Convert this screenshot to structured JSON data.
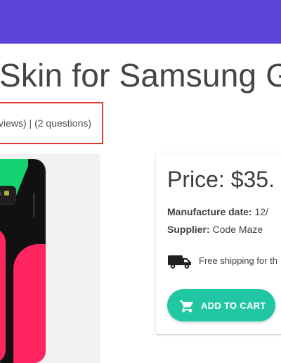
{
  "header": {
    "background_color": "#5b45d8"
  },
  "product": {
    "title": "Skin for Samsung G",
    "reviews_questions": "views) | (2 questions)",
    "image": {
      "name": "phone-skin-image",
      "colors": {
        "background": "#f2f2f2",
        "phone": "#111111",
        "green": "#15d273",
        "pink": "#ff265f"
      }
    }
  },
  "details": {
    "price": "Price: $35.",
    "manufacture_label": "Manufacture date:",
    "manufacture_value": "12/",
    "supplier_label": "Supplier:",
    "supplier_value": "Code Maze",
    "shipping_text": "Free shipping for th",
    "add_to_cart_label": "ADD TO CART",
    "button_color": "#21c7a2"
  },
  "icons": {
    "truck": "truck-icon",
    "cart": "shopping-cart-icon"
  },
  "annotation_color": "#dd3d35"
}
